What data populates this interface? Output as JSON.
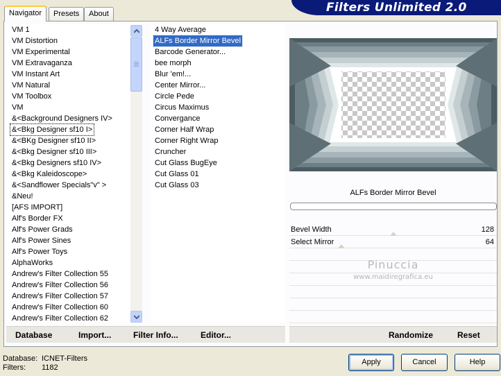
{
  "app": {
    "title": "Filters Unlimited 2.0"
  },
  "tabs": [
    {
      "label": "Navigator",
      "active": true
    },
    {
      "label": "Presets",
      "active": false
    },
    {
      "label": "About",
      "active": false
    }
  ],
  "categories": [
    "VM 1",
    "VM Distortion",
    "VM Experimental",
    "VM Extravaganza",
    "VM Instant Art",
    "VM Natural",
    "VM Toolbox",
    "VM",
    "&<Background Designers IV>",
    "&<Bkg Designer sf10 I>",
    "&<BKg Designer sf10 II>",
    "&<Bkg Designer sf10 III>",
    "&<Bkg Designers sf10 IV>",
    "&<Bkg Kaleidoscope>",
    "&<Sandflower Specials\"v\" >",
    "&Neu!",
    "[AFS IMPORT]",
    "Alf's Border FX",
    "Alf's Power Grads",
    "Alf's Power Sines",
    "Alf's Power Toys",
    "AlphaWorks",
    "Andrew's Filter Collection 55",
    "Andrew's Filter Collection 56",
    "Andrew's Filter Collection 57",
    "Andrew's Filter Collection 60",
    "Andrew's Filter Collection 62"
  ],
  "selected_category": "&<Bkg Designer sf10 I>",
  "filters": [
    "4 Way Average",
    "ALFs Border Mirror Bevel",
    "Barcode Generator...",
    "bee morph",
    "Blur 'em!...",
    "Center Mirror...",
    "Circle Pede",
    "Circus Maximus",
    "Convergance",
    "Corner Half Wrap",
    "Corner Right Wrap",
    "Cruncher",
    "Cut Glass  BugEye",
    "Cut Glass 01",
    "Cut Glass 03"
  ],
  "selected_filter": "ALFs Border Mirror Bevel",
  "preview": {
    "filter_name": "ALFs Border Mirror Bevel",
    "progress": 0
  },
  "params": [
    {
      "label": "Bevel Width",
      "value": "128",
      "fraction": 0.5
    },
    {
      "label": "Select Mirror",
      "value": "64",
      "fraction": 0.25
    }
  ],
  "watermark": {
    "line1": "Pinuccia",
    "line2": "www.maidiregrafica.eu"
  },
  "links": {
    "database": "Database",
    "import": "Import...",
    "filter_info": "Filter Info...",
    "editor": "Editor...",
    "randomize": "Randomize",
    "reset": "Reset"
  },
  "footer": {
    "database_label": "Database:",
    "database_value": "ICNET-Filters",
    "filters_label": "Filters:",
    "filters_value": "1182"
  },
  "buttons": {
    "apply": "Apply",
    "cancel": "Cancel",
    "help": "Help"
  },
  "colors": {
    "selection": "#316ac5",
    "banner": "#0a1a78",
    "tab_highlight": "#ffc83c"
  }
}
